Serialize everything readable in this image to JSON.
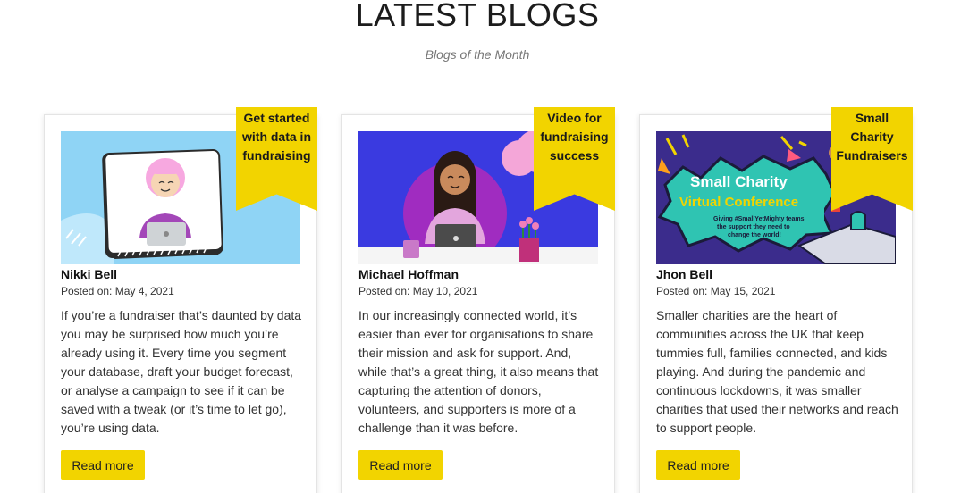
{
  "section": {
    "title": "LATEST BLOGS",
    "subtitle": "Blogs of the Month"
  },
  "accent_color": "#f2d400",
  "cards": [
    {
      "ribbon_lines": [
        "Get started",
        "with data in",
        "fundraising"
      ],
      "author": "Nikki Bell",
      "posted": "Posted on: May 4, 2021",
      "excerpt": "If you’re a fundraiser that’s daunted by data you may be surprised how much you’re already using it. Every time you segment your database, draft your budget forecast, or analyse a campaign to see if it can be saved with a tweak (or it’s time to let go), you’re using data.",
      "button": "Read more"
    },
    {
      "ribbon_lines": [
        "Video for",
        "fundraising",
        "success"
      ],
      "author": "Michael Hoffman",
      "posted": "Posted on: May 10, 2021",
      "excerpt": "In our increasingly connected world, it’s easier than ever for organisations to share their mission and ask for support. And, while that’s a great thing, it also means that capturing the attention of donors, volunteers, and supporters is more of a challenge than it was before.",
      "button": "Read more"
    },
    {
      "ribbon_lines": [
        "Small",
        "Charity",
        "Fundraisers"
      ],
      "author": "Jhon Bell",
      "posted": "Posted on: May 15, 2021",
      "excerpt": "Smaller charities are the heart of communities across the UK that keep tummies full, families connected, and kids playing. And during the pandemic and continuous lockdowns, it was smaller charities that used their networks and reach to support people.",
      "button": "Read more",
      "image_text": {
        "line1": "Small Charity",
        "line2": "Virtual Conference",
        "line3": "Giving #SmallYetMighty teams",
        "line4": "the support they need to",
        "line5": "change the world!"
      }
    }
  ]
}
